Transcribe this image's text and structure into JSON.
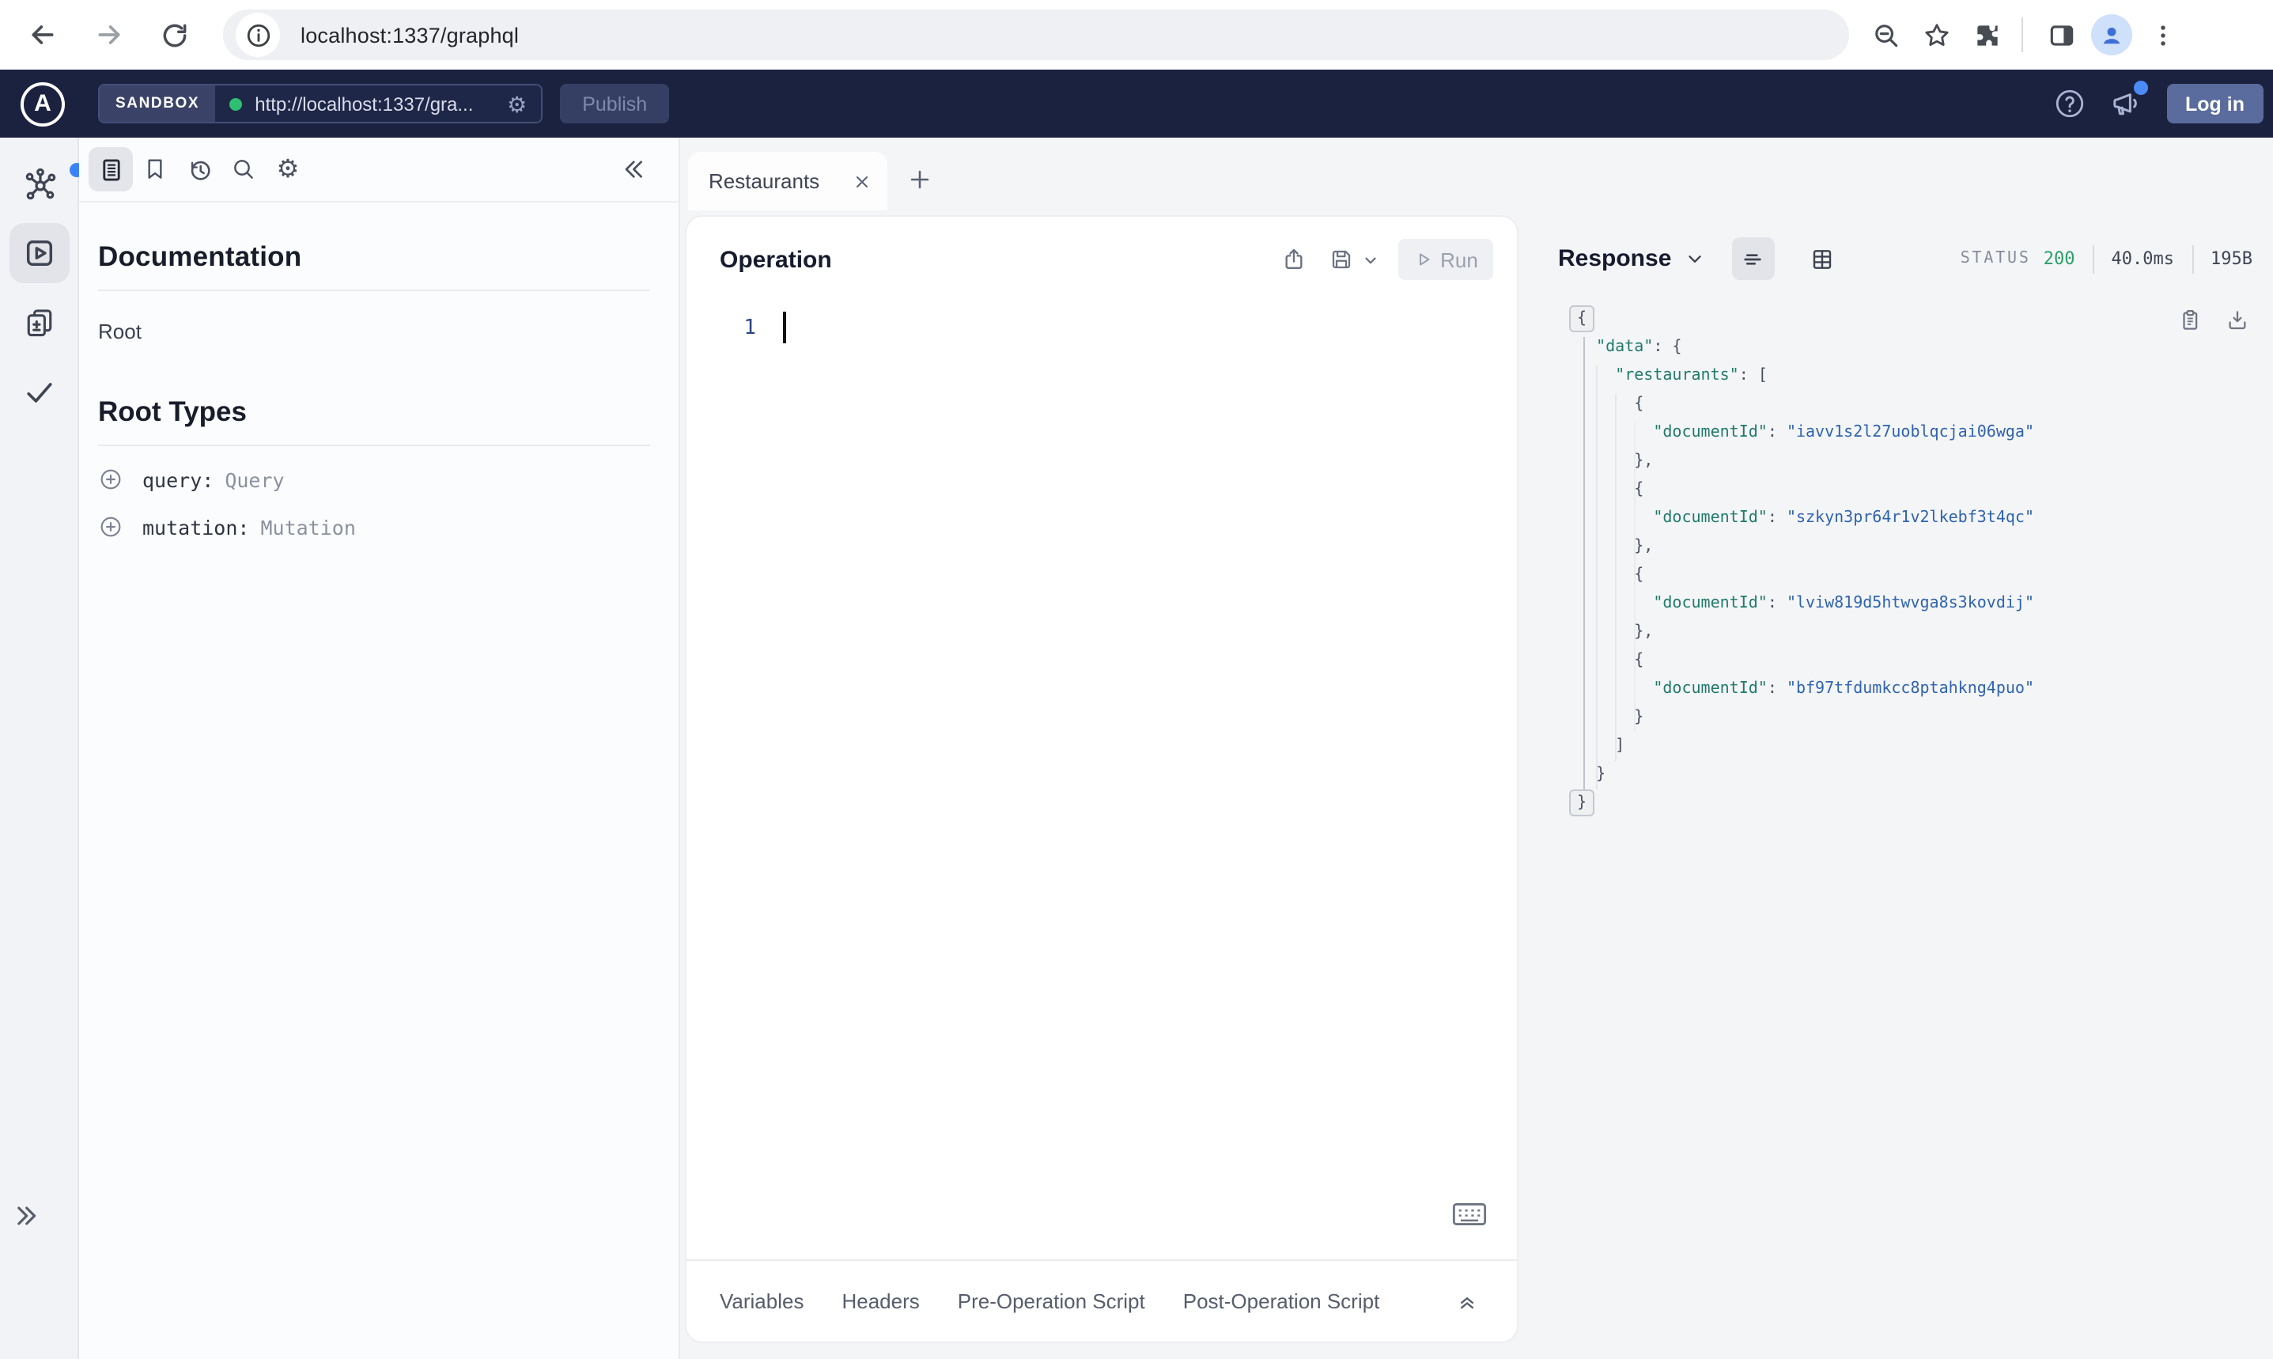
{
  "browser": {
    "url": "localhost:1337/graphql"
  },
  "app_header": {
    "sandbox_label": "SANDBOX",
    "endpoint_url": "http://localhost:1337/gra...",
    "publish_label": "Publish",
    "login_label": "Log in"
  },
  "docs_panel": {
    "title": "Documentation",
    "root_item": "Root",
    "root_types_title": "Root Types",
    "root_types": [
      {
        "field": "query:",
        "type": "Query"
      },
      {
        "field": "mutation:",
        "type": "Mutation"
      }
    ]
  },
  "tab_bar": {
    "active_tab": "Restaurants"
  },
  "operation_panel": {
    "title": "Operation",
    "run_label": "Run",
    "line_number": "1"
  },
  "operation_footer": {
    "tabs": [
      "Variables",
      "Headers",
      "Pre-Operation Script",
      "Post-Operation Script"
    ]
  },
  "response_panel": {
    "title": "Response",
    "status_label": "STATUS",
    "status_code": "200",
    "duration": "40.0ms",
    "size": "195B",
    "body_lines": [
      "{",
      "  \"data\": {",
      "    \"restaurants\": [",
      "      {",
      "        \"documentId\": \"iavv1s2l27uoblqcjai06wga\"",
      "      },",
      "      {",
      "        \"documentId\": \"szkyn3pr64r1v2lkebf3t4qc\"",
      "      },",
      "      {",
      "        \"documentId\": \"lviw819d5htwvga8s3kovdij\"",
      "      },",
      "      {",
      "        \"documentId\": \"bf97tfdumkcc8ptahkng4puo\"",
      "      }",
      "    ]",
      "  }",
      "}"
    ]
  },
  "colors": {
    "header_bg": "#1b2240",
    "notification_blue": "#3b82f6",
    "status_green": "#2aa06a",
    "json_key_teal": "#217a6c",
    "json_string_blue": "#2f63b0",
    "endpoint_dot_green": "#2fbf71"
  }
}
